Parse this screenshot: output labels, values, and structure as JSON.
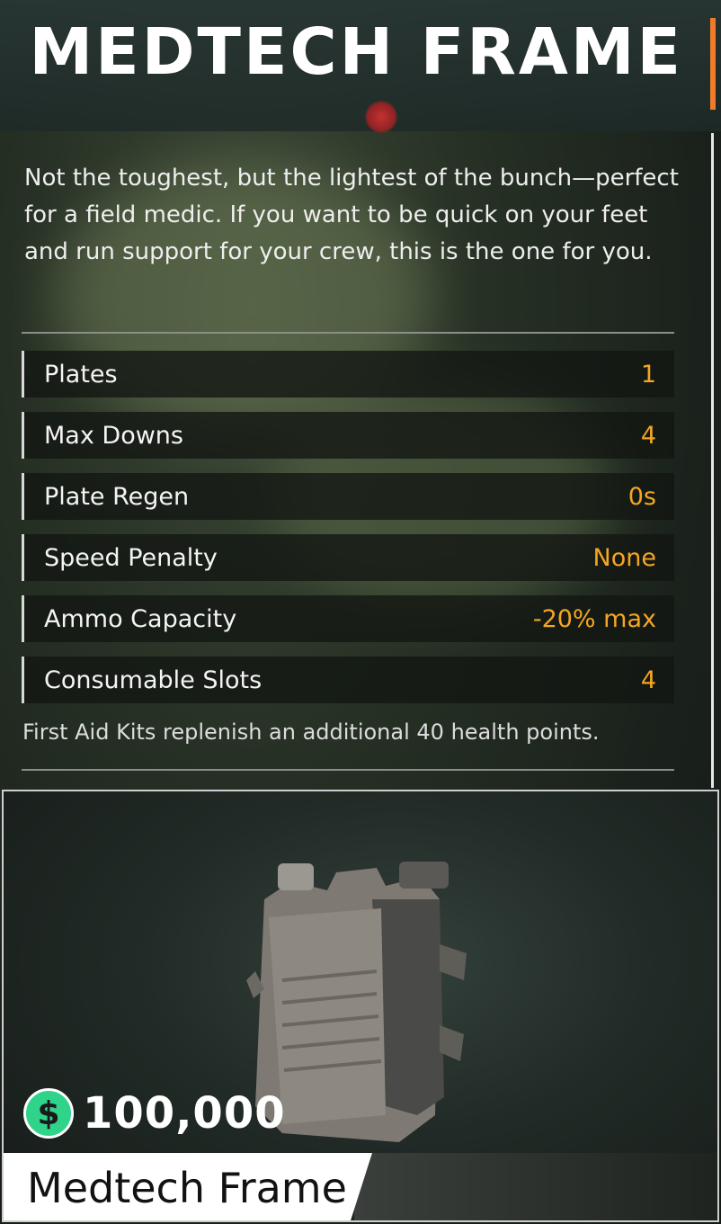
{
  "header": {
    "title": "MEDTECH FRAME"
  },
  "description": "Not the toughest, but the lightest of the bunch—perfect for a field medic. If you want to be quick on your feet and run support for your crew, this is the one for you.",
  "stats": [
    {
      "label": "Plates",
      "value": "1"
    },
    {
      "label": "Max Downs",
      "value": "4"
    },
    {
      "label": "Plate Regen",
      "value": "0s"
    },
    {
      "label": "Speed Penalty",
      "value": "None"
    },
    {
      "label": "Ammo Capacity",
      "value": "-20% max"
    },
    {
      "label": "Consumable Slots",
      "value": "4"
    }
  ],
  "note": "First Aid Kits replenish an additional 40 health points.",
  "item": {
    "price_symbol": "$",
    "price": "100,000",
    "name": "Medtech Frame"
  },
  "colors": {
    "accent_orange": "#f07c2a",
    "stat_value": "#f5a623",
    "currency_green": "#2fd48a"
  }
}
